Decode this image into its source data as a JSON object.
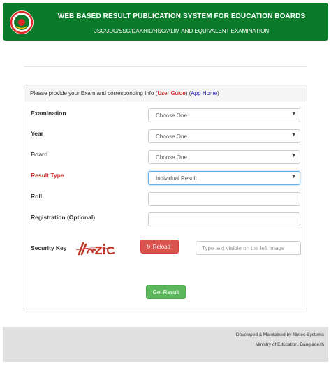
{
  "header": {
    "title": "WEB BASED RESULT PUBLICATION SYSTEM FOR EDUCATION BOARDS",
    "subtitle": "JSC/JDC/SSC/DAKHIL/HSC/ALIM AND EQUIVALENT EXAMINATION",
    "colors": {
      "bar": "#0b7a2b",
      "seal_ring": "#e02a2a"
    }
  },
  "form": {
    "intro_text": "Please provide your Exam and corresponding Info (",
    "user_guide": "User Guide",
    "close_paren": ")",
    "app_home": "App Home",
    "close_paren2": ")",
    "examination": {
      "label": "Examination",
      "value": "Choose One"
    },
    "year": {
      "label": "Year",
      "value": "Choose One"
    },
    "board": {
      "label": "Board",
      "value": "Choose One"
    },
    "result_type": {
      "label": "Result Type",
      "value": "Individual Result"
    },
    "roll": {
      "label": "Roll",
      "value": ""
    },
    "registration": {
      "label": "Registration (Optional)",
      "value": ""
    },
    "security": {
      "label": "Security Key",
      "reload_label": "Reload",
      "input_placeholder": "Type text visible on the left image"
    },
    "submit_label": "Get Result",
    "caret": "▼"
  },
  "footer": {
    "developer": "Developed & Maintained by Nixtec Systems",
    "ministry": "Ministry of Education, Bangladesh"
  },
  "icons": {
    "reload": "refresh-icon",
    "logo": "government-seal-icon"
  }
}
